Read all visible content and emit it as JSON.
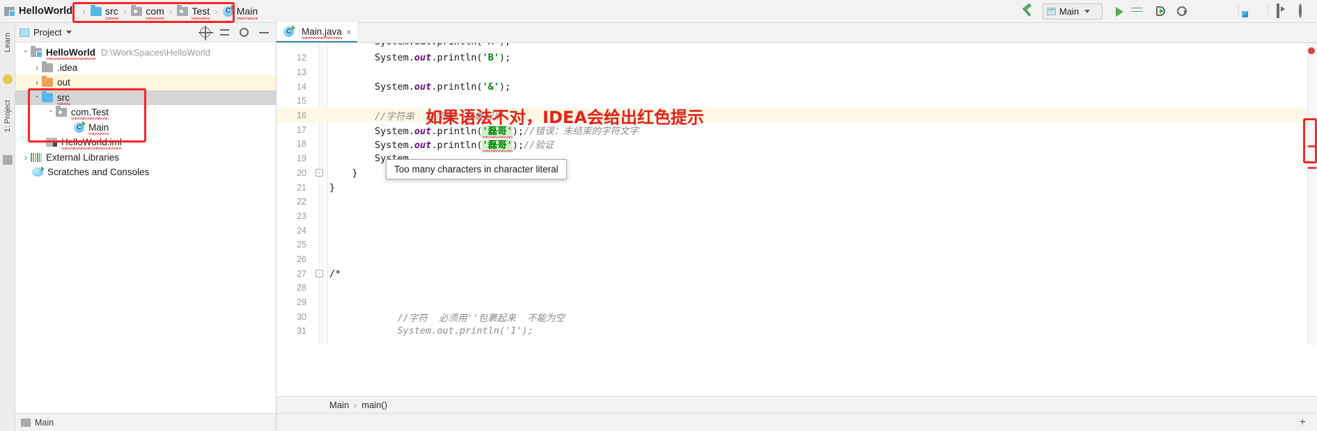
{
  "toolbar": {
    "project_name": "HelloWorld",
    "breadcrumbs": [
      {
        "label": "src",
        "icon": "folder-blue-icon"
      },
      {
        "label": "com",
        "icon": "folder-package-icon"
      },
      {
        "label": "Test",
        "icon": "folder-package-icon"
      },
      {
        "label": "Main",
        "icon": "java-class-icon"
      }
    ],
    "separator": "›",
    "build_icon": "hammer-icon",
    "run_config": "Main",
    "icons": [
      "run-icon",
      "debug-icon",
      "run-with-coverage-icon",
      "profiler-icon",
      "attach-icon",
      "stop-icon",
      "project-structure-icon",
      "window-icon",
      "search-icon"
    ]
  },
  "rail": {
    "learn": "Learn",
    "project": "1: Project"
  },
  "panel": {
    "title": "Project",
    "actions": [
      "locate-icon",
      "collapse-all-icon",
      "settings-gear-icon",
      "hide-icon"
    ],
    "tree": [
      {
        "label": "HelloWorld",
        "path": "D:\\WorkSpaces\\HelloWorld",
        "icon": "module-icon",
        "indent": 0,
        "arrow": "open",
        "bold": true
      },
      {
        "label": ".idea",
        "icon": "folder-gray-icon",
        "indent": 1,
        "arrow": "closed"
      },
      {
        "label": "out",
        "icon": "folder-orange-icon",
        "indent": 1,
        "arrow": "closed",
        "state": "highlight"
      },
      {
        "label": "src",
        "icon": "folder-blue-icon",
        "indent": 1,
        "arrow": "open",
        "state": "selected"
      },
      {
        "label": "com.Test",
        "icon": "package-icon",
        "indent": 2,
        "arrow": "open"
      },
      {
        "label": "Main",
        "icon": "java-class-icon",
        "indent": 3,
        "arrow": "none"
      },
      {
        "label": "HelloWorld.iml",
        "icon": "iml-file-icon",
        "indent": 1,
        "arrow": "none"
      },
      {
        "label": "External Libraries",
        "icon": "libraries-icon",
        "indent": 0,
        "arrow": "closed"
      },
      {
        "label": "Scratches and Consoles",
        "icon": "scratches-icon",
        "indent": 0,
        "arrow": "none"
      }
    ],
    "bottom_label": "Main"
  },
  "editor": {
    "tab": {
      "label": "Main.java",
      "icon": "java-class-icon",
      "close": "×"
    },
    "first_partial_line": "System.out.println('A');",
    "lines": [
      {
        "num": "12",
        "segments": [
          {
            "t": "        System.",
            "c": "plain"
          },
          {
            "t": "out",
            "c": "field"
          },
          {
            "t": ".println(",
            "c": "plain"
          },
          {
            "t": "'B'",
            "c": "char"
          },
          {
            "t": ");",
            "c": "plain"
          }
        ]
      },
      {
        "num": "13",
        "segments": []
      },
      {
        "num": "14",
        "segments": [
          {
            "t": "        System.",
            "c": "plain"
          },
          {
            "t": "out",
            "c": "field"
          },
          {
            "t": ".println(",
            "c": "plain"
          },
          {
            "t": "'&'",
            "c": "char"
          },
          {
            "t": ");",
            "c": "plain"
          }
        ]
      },
      {
        "num": "15",
        "segments": []
      },
      {
        "num": "16",
        "caret": true,
        "segments": [
          {
            "t": "        //字符串  必须用\"\"包裹起来",
            "c": "comment"
          }
        ]
      },
      {
        "num": "17",
        "segments": [
          {
            "t": "        System.",
            "c": "plain"
          },
          {
            "t": "out",
            "c": "field"
          },
          {
            "t": ".println(",
            "c": "plain"
          },
          {
            "t": "'磊哥'",
            "c": "error-char"
          },
          {
            "t": ");",
            "c": "plain"
          },
          {
            "t": "//错误：未结束的字符文字",
            "c": "comment"
          }
        ]
      },
      {
        "num": "18",
        "segments": [
          {
            "t": "        System.",
            "c": "plain"
          },
          {
            "t": "out",
            "c": "field"
          },
          {
            "t": ".println(",
            "c": "plain"
          },
          {
            "t": "'磊哥'",
            "c": "error-char"
          },
          {
            "t": ");",
            "c": "plain"
          },
          {
            "t": "//验证",
            "c": "comment"
          }
        ]
      },
      {
        "num": "19",
        "segments": [
          {
            "t": "        System",
            "c": "plain"
          }
        ]
      },
      {
        "num": "20",
        "fold": "-",
        "segments": [
          {
            "t": "    }",
            "c": "plain"
          }
        ]
      },
      {
        "num": "21",
        "segments": [
          {
            "t": "}",
            "c": "plain"
          }
        ]
      },
      {
        "num": "22",
        "segments": []
      },
      {
        "num": "23",
        "segments": []
      },
      {
        "num": "24",
        "segments": []
      },
      {
        "num": "25",
        "segments": []
      },
      {
        "num": "26",
        "segments": []
      },
      {
        "num": "27",
        "fold": "-",
        "segments": [
          {
            "t": "/*",
            "c": "plain"
          }
        ]
      },
      {
        "num": "28",
        "segments": []
      },
      {
        "num": "29",
        "segments": []
      },
      {
        "num": "30",
        "segments": [
          {
            "t": "            //字符  必须用''包裹起来  不能为空",
            "c": "comment"
          }
        ]
      },
      {
        "num": "31",
        "segments": [
          {
            "t": "            System.out.println('1');",
            "c": "comment"
          }
        ]
      }
    ],
    "tooltip": "Too many characters in character literal",
    "annotation": "如果语法不对，IDEA会给出红色提示",
    "breadcrumb": {
      "class": "Main",
      "method": "main()",
      "separator": "›"
    }
  },
  "colors": {
    "accent_blue": "#3d87c9",
    "annotation_red": "#fb2424",
    "error_red": "#e04343",
    "char_green": "#008000",
    "highlight_green": "#cdf0cd",
    "caret_line": "#fdf8e3"
  }
}
